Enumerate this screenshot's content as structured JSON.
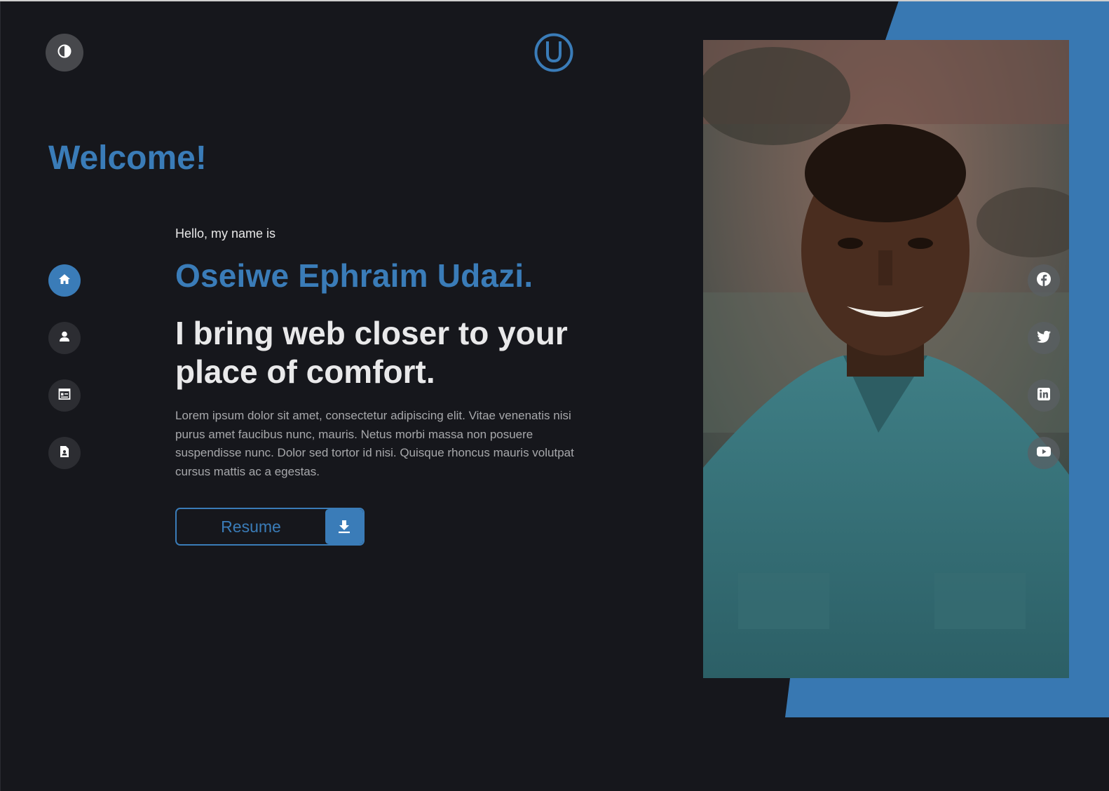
{
  "header": {
    "theme_toggle_icon": "contrast-icon",
    "logo_icon": "u-logo-icon"
  },
  "hero": {
    "welcome": "Welcome!",
    "greeting": "Hello, my name is",
    "name": "Oseiwe Ephraim Udazi.",
    "tagline": "I bring web closer to your place of comfort.",
    "description": "Lorem ipsum dolor sit amet, consectetur adipiscing elit. Vitae venenatis nisi purus amet faucibus nunc, mauris. Netus morbi massa non posuere suspendisse nunc. Dolor sed tortor id nisi. Quisque rhoncus mauris volutpat cursus mattis ac a egestas.",
    "resume_button": "Resume",
    "resume_icon": "download-icon"
  },
  "nav": {
    "items": [
      {
        "icon": "home-icon",
        "active": true
      },
      {
        "icon": "user-icon",
        "active": false
      },
      {
        "icon": "portfolio-icon",
        "active": false
      },
      {
        "icon": "document-icon",
        "active": false
      }
    ]
  },
  "socials": {
    "items": [
      {
        "icon": "facebook-icon"
      },
      {
        "icon": "twitter-icon"
      },
      {
        "icon": "linkedin-icon"
      },
      {
        "icon": "youtube-icon"
      }
    ]
  },
  "colors": {
    "accent": "#3a7cb8",
    "background": "#16171c",
    "text": "#e9e9ea",
    "muted": "#a7a8ab"
  }
}
